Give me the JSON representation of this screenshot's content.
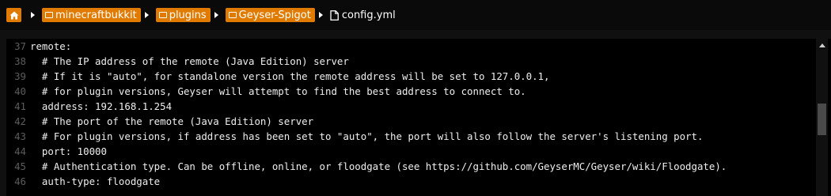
{
  "breadcrumb": {
    "items": [
      {
        "label": "minecraftbukkit"
      },
      {
        "label": "plugins"
      },
      {
        "label": "Geyser-Spigot"
      }
    ],
    "file": "config.yml"
  },
  "editor": {
    "lines": [
      {
        "num": "37",
        "text": "remote:"
      },
      {
        "num": "38",
        "text": "  # The IP address of the remote (Java Edition) server"
      },
      {
        "num": "39",
        "text": "  # If it is \"auto\", for standalone version the remote address will be set to 127.0.0.1,"
      },
      {
        "num": "40",
        "text": "  # for plugin versions, Geyser will attempt to find the best address to connect to."
      },
      {
        "num": "41",
        "text": "  address: 192.168.1.254"
      },
      {
        "num": "42",
        "text": "  # The port of the remote (Java Edition) server"
      },
      {
        "num": "43",
        "text": "  # For plugin versions, if address has been set to \"auto\", the port will also follow the server's listening port."
      },
      {
        "num": "44",
        "text": "  port: 10000"
      },
      {
        "num": "45",
        "text": "  # Authentication type. Can be offline, online, or floodgate (see https://github.com/GeyserMC/Geyser/wiki/Floodgate)."
      },
      {
        "num": "46",
        "text": "  auth-type: floodgate"
      }
    ]
  },
  "colors": {
    "accent": "#e07b00",
    "background": "#101010",
    "editor_bg": "#000000",
    "line_number": "#5c5c5c",
    "text": "#eeeeee"
  }
}
